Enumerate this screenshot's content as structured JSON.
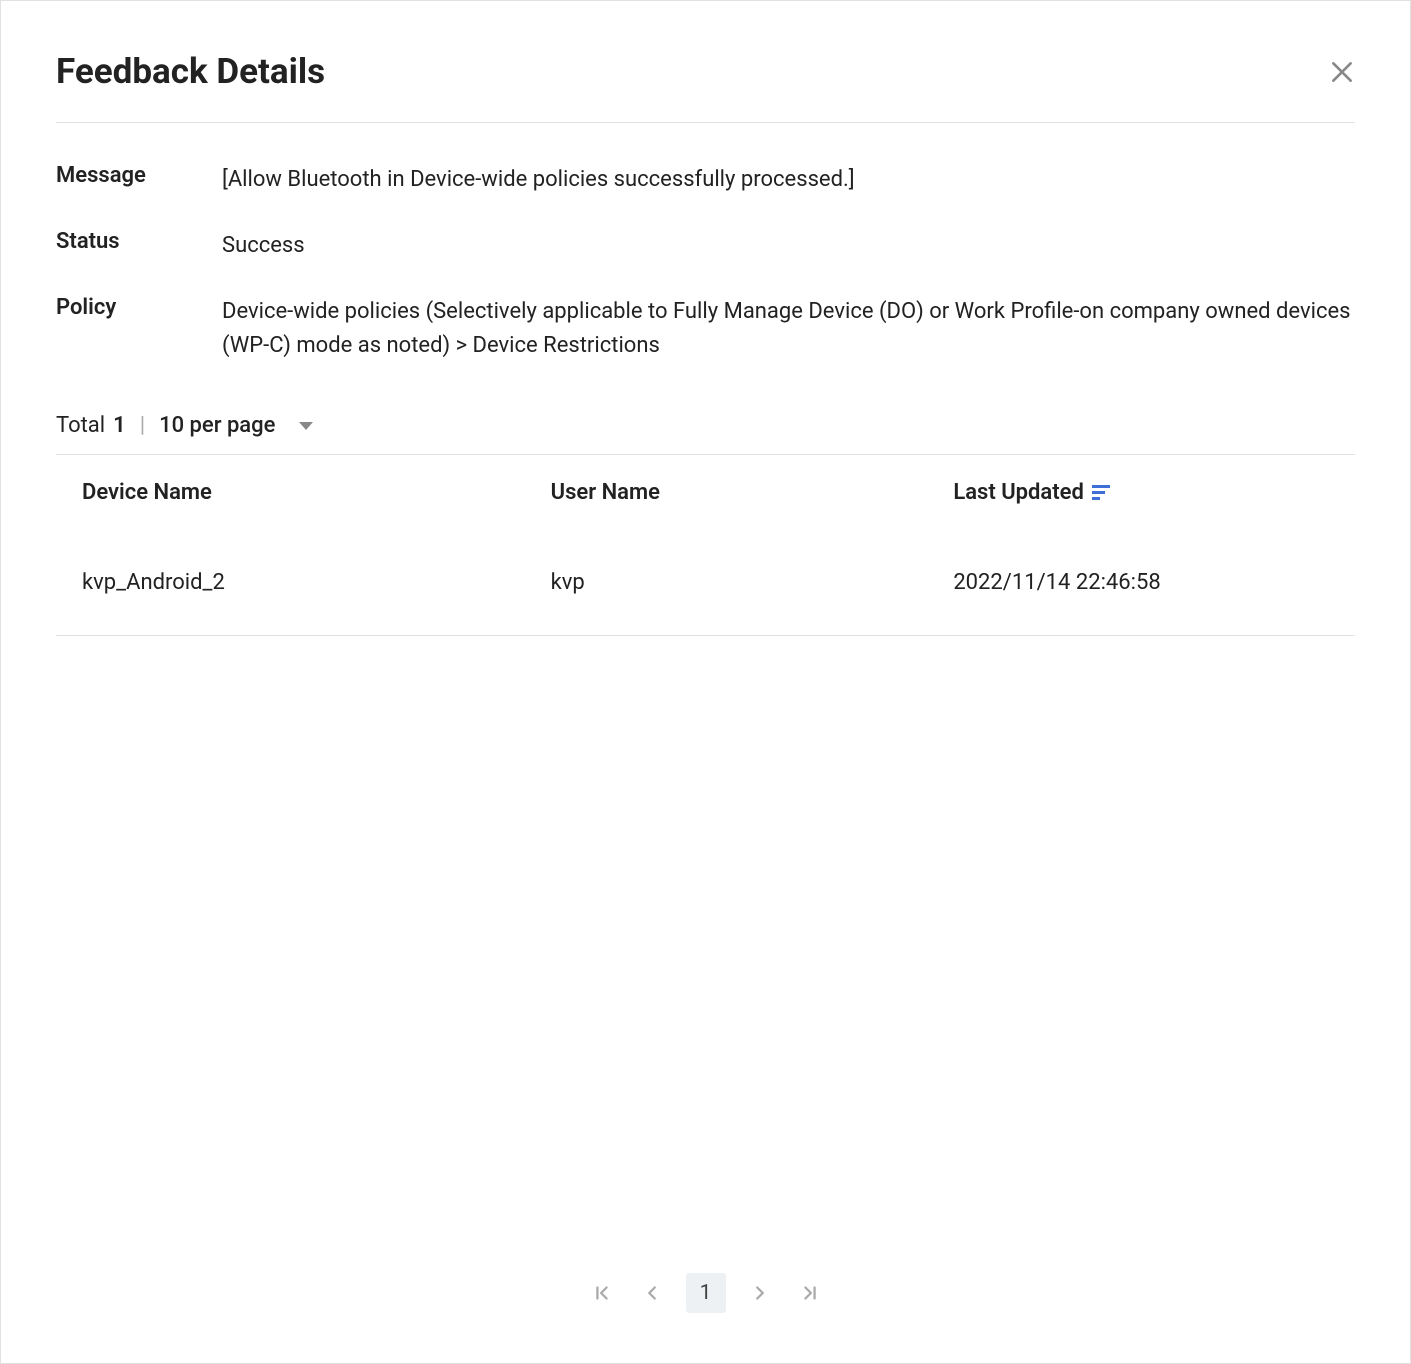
{
  "header": {
    "title": "Feedback Details"
  },
  "details": {
    "labels": {
      "message": "Message",
      "status": "Status",
      "policy": "Policy"
    },
    "values": {
      "message": "[Allow Bluetooth in Device-wide policies successfully processed.]",
      "status": "Success",
      "policy": "Device-wide policies (Selectively applicable to Fully Manage Device (DO) or Work Profile-on company owned devices (WP-C) mode as noted) > Device Restrictions"
    }
  },
  "table_controls": {
    "total_label": "Total",
    "total_count": "1",
    "divider": "|",
    "per_page": "10 per page"
  },
  "table": {
    "columns": {
      "device_name": "Device Name",
      "user_name": "User Name",
      "last_updated": "Last Updated"
    },
    "rows": [
      {
        "device_name": "kvp_Android_2",
        "user_name": "kvp",
        "last_updated": "2022/11/14 22:46:58"
      }
    ]
  },
  "pagination": {
    "current": "1"
  }
}
